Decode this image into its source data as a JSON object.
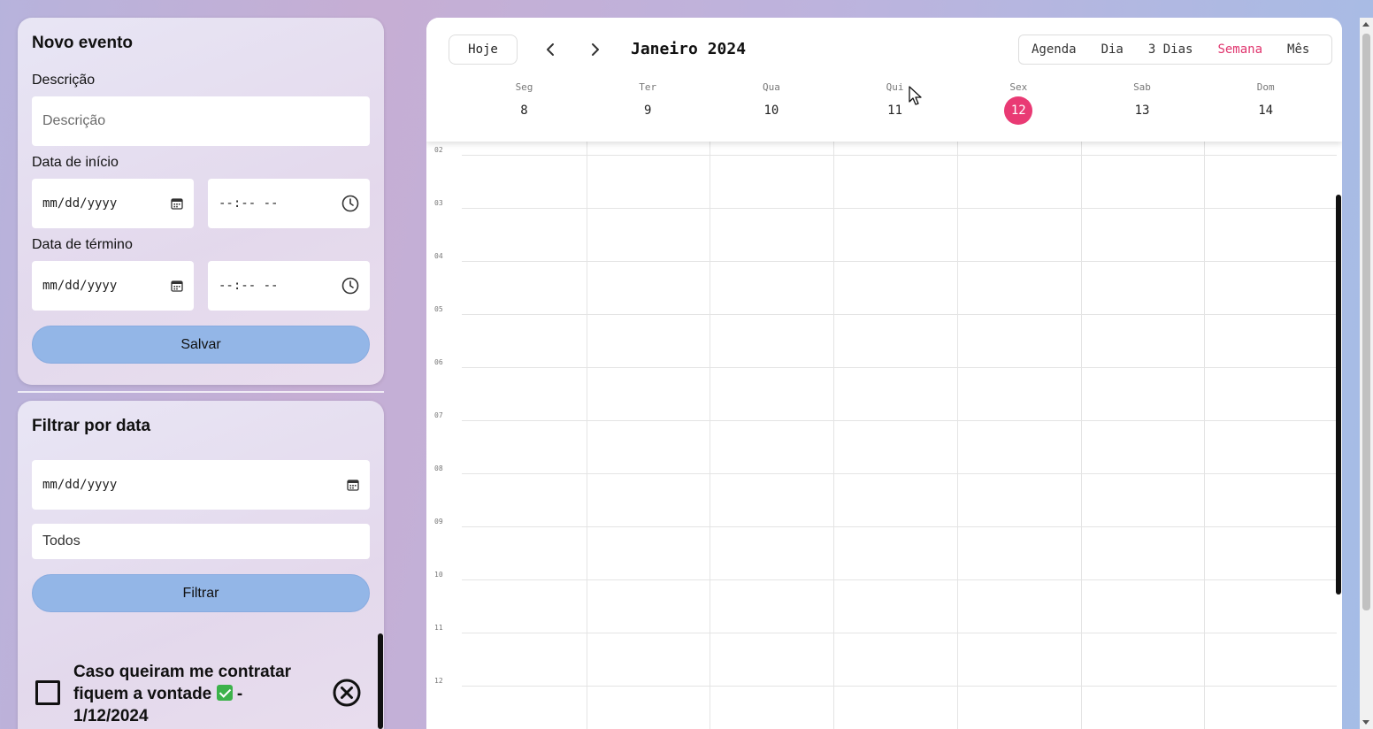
{
  "new_event": {
    "title": "Novo evento",
    "description_label": "Descrição",
    "description_placeholder": "Descrição",
    "start_label": "Data de início",
    "start_date_placeholder": "mm/dd/yyyy",
    "start_time_placeholder": "--:-- --",
    "end_label": "Data de término",
    "end_date_placeholder": "mm/dd/yyyy",
    "end_time_placeholder": "--:-- --",
    "save_label": "Salvar"
  },
  "filter": {
    "title": "Filtrar por data",
    "date_placeholder": "mm/dd/yyyy",
    "select_value": "Todos",
    "filter_label": "Filtrar"
  },
  "todo": {
    "text_before": "Caso queiram me contratar fiquem a vontade",
    "text_after": "- 1/12/2024",
    "checked": false
  },
  "calendar": {
    "today_label": "Hoje",
    "month_title": "Janeiro 2024",
    "views": [
      "Agenda",
      "Dia",
      "3 Dias",
      "Semana",
      "Mês"
    ],
    "active_view": "Semana",
    "accent_color": "#e93a74",
    "days": [
      {
        "name": "Seg",
        "num": "8"
      },
      {
        "name": "Ter",
        "num": "9"
      },
      {
        "name": "Qua",
        "num": "10"
      },
      {
        "name": "Qui",
        "num": "11"
      },
      {
        "name": "Sex",
        "num": "12",
        "today": true
      },
      {
        "name": "Sab",
        "num": "13"
      },
      {
        "name": "Dom",
        "num": "14"
      }
    ],
    "hours": [
      "02",
      "03",
      "04",
      "05",
      "06",
      "07",
      "08",
      "09",
      "10",
      "11",
      "12"
    ]
  }
}
